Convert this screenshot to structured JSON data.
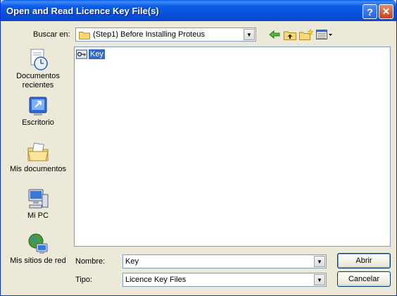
{
  "window": {
    "title": "Open and Read Licence Key File(s)",
    "help_label": "?",
    "close_label": "✕"
  },
  "lookin": {
    "label": "Buscar en:",
    "value": "(Step1) Before Installing Proteus"
  },
  "places": [
    {
      "label": "Documentos recientes",
      "icon": "recent-documents-icon"
    },
    {
      "label": "Escritorio",
      "icon": "desktop-icon"
    },
    {
      "label": "Mis documentos",
      "icon": "my-documents-icon"
    },
    {
      "label": "Mi PC",
      "icon": "my-computer-icon"
    },
    {
      "label": "Mis sitios de red",
      "icon": "network-places-icon"
    }
  ],
  "files": [
    {
      "name": "Key",
      "icon": "key-file-icon",
      "selected": true
    }
  ],
  "filename": {
    "label": "Nombre:",
    "value": "Key"
  },
  "filetype": {
    "label": "Tipo:",
    "value": "Licence Key Files"
  },
  "buttons": {
    "open": "Abrir",
    "cancel": "Cancelar"
  },
  "colors": {
    "titlebar": "#0a5cf0",
    "dialog_bg": "#ece9d8",
    "selection": "#316ac5",
    "close_button": "#c9401c"
  }
}
